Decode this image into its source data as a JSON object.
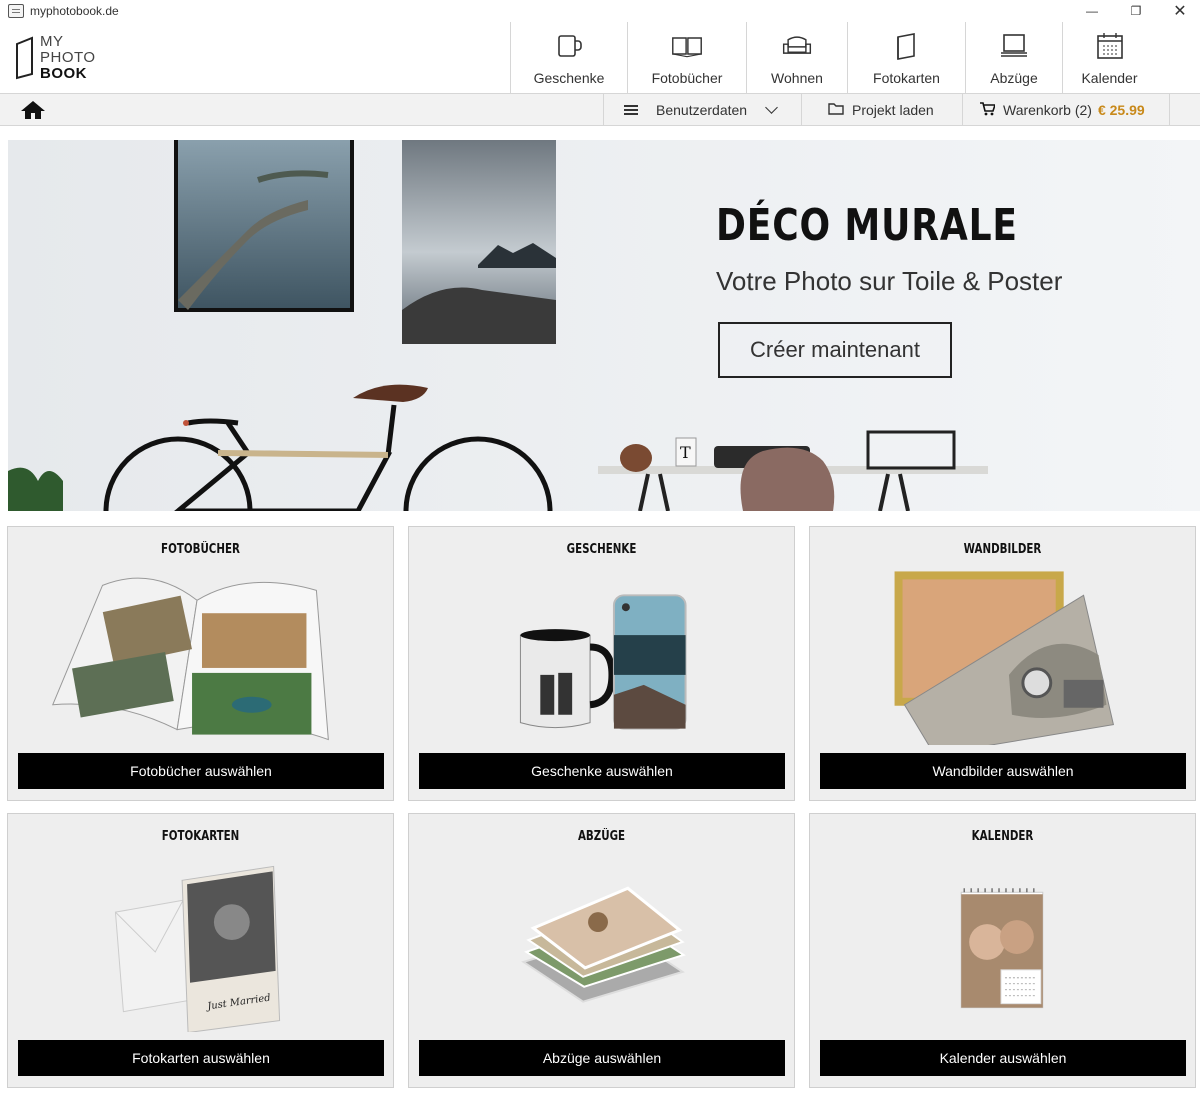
{
  "window": {
    "title": "myphotobook.de"
  },
  "logo": {
    "line1": "MY",
    "line2": "PHOTO",
    "line3": "BOOK"
  },
  "nav": [
    {
      "label": "Geschenke",
      "icon": "mug-icon"
    },
    {
      "label": "Fotobücher",
      "icon": "book-icon"
    },
    {
      "label": "Wohnen",
      "icon": "sofa-icon"
    },
    {
      "label": "Fotokarten",
      "icon": "card-icon"
    },
    {
      "label": "Abzüge",
      "icon": "prints-icon"
    },
    {
      "label": "Kalender",
      "icon": "calendar-icon"
    }
  ],
  "subbar": {
    "userdata": "Benutzerdaten",
    "load_project": "Projekt laden",
    "cart": "Warenkorb (2)",
    "cart_price": "€ 25.99"
  },
  "hero": {
    "title": "DÉCO MURALE",
    "subtitle": "Votre Photo sur Toile & Poster",
    "cta": "Créer maintenant"
  },
  "cards": [
    {
      "title": "FOTOBÜCHER",
      "button": "Fotobücher auswählen"
    },
    {
      "title": "GESCHENKE",
      "button": "Geschenke auswählen"
    },
    {
      "title": "WANDBILDER",
      "button": "Wandbilder auswählen"
    },
    {
      "title": "FOTOKARTEN",
      "button": "Fotokarten auswählen"
    },
    {
      "title": "ABZÜGE",
      "button": "Abzüge auswählen"
    },
    {
      "title": "KALENDER",
      "button": "Kalender auswählen"
    }
  ],
  "colors": {
    "accent_price": "#c8891a",
    "button_bg": "#000000",
    "card_bg": "#eeeeee"
  }
}
